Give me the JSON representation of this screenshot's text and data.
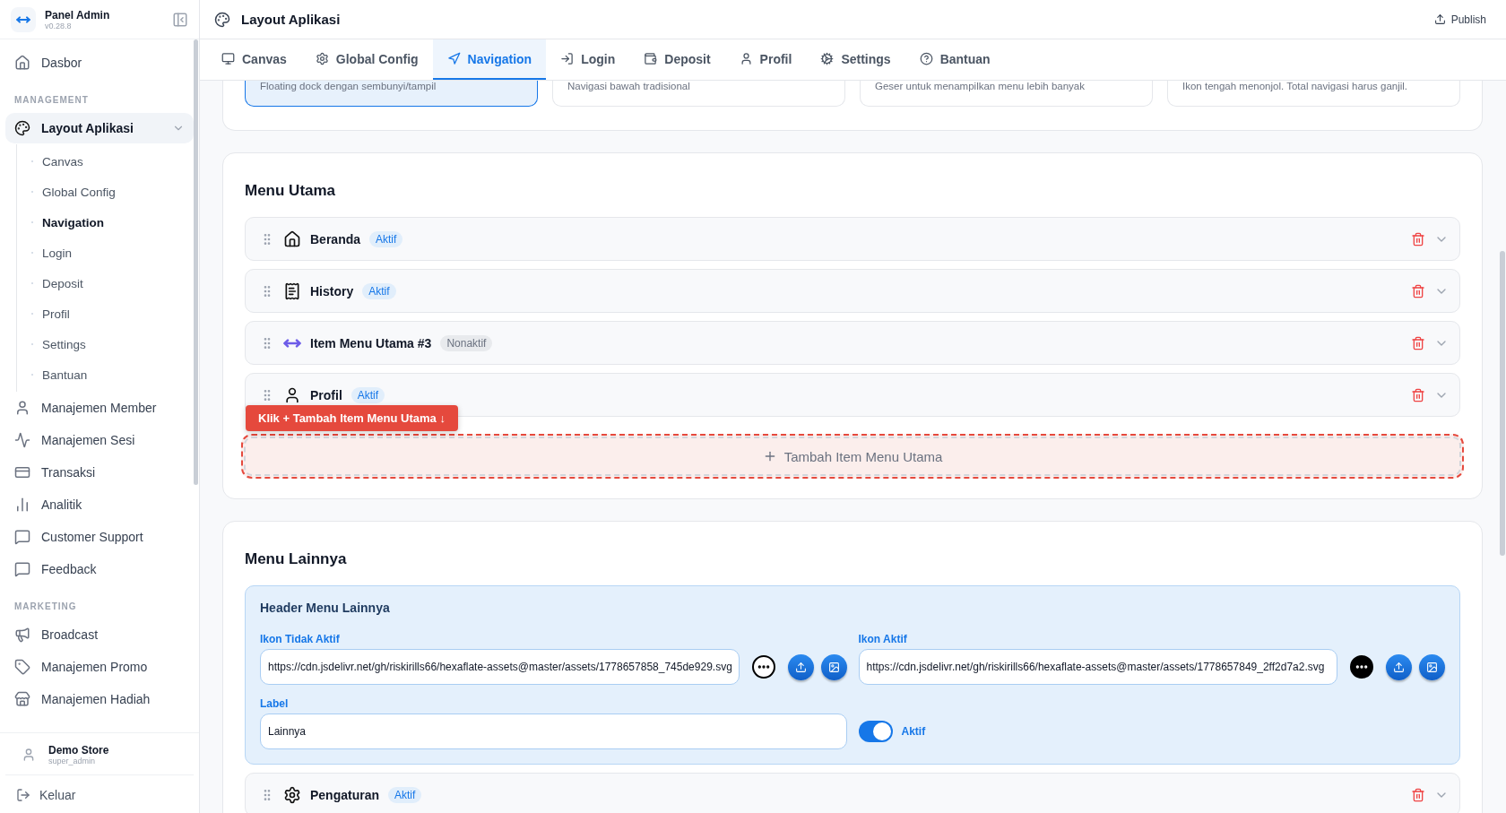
{
  "brand": {
    "title": "Panel Admin",
    "version": "v0.28.8"
  },
  "sidebar": {
    "sections": [
      {
        "items": [
          {
            "label": "Dasbor",
            "selected": false
          }
        ]
      },
      {
        "title": "MANAGEMENT",
        "items": [
          {
            "label": "Layout Aplikasi",
            "selected": true,
            "expanded": true,
            "children": [
              {
                "label": "Canvas",
                "selected": false
              },
              {
                "label": "Global Config",
                "selected": false
              },
              {
                "label": "Navigation",
                "selected": true
              },
              {
                "label": "Login",
                "selected": false
              },
              {
                "label": "Deposit",
                "selected": false
              },
              {
                "label": "Profil",
                "selected": false
              },
              {
                "label": "Settings",
                "selected": false
              },
              {
                "label": "Bantuan",
                "selected": false
              }
            ]
          },
          {
            "label": "Manajemen Member",
            "selected": false
          },
          {
            "label": "Manajemen Sesi",
            "selected": false
          },
          {
            "label": "Transaksi",
            "selected": false
          },
          {
            "label": "Analitik",
            "selected": false
          },
          {
            "label": "Customer Support",
            "selected": false
          },
          {
            "label": "Feedback",
            "selected": false
          }
        ]
      },
      {
        "title": "MARKETING",
        "items": [
          {
            "label": "Broadcast",
            "selected": false
          },
          {
            "label": "Manajemen Promo",
            "selected": false
          },
          {
            "label": "Manajemen Hadiah",
            "selected": false
          }
        ]
      }
    ]
  },
  "user": {
    "name": "Demo Store",
    "role": "super_admin"
  },
  "logout": "Keluar",
  "page": {
    "title": "Layout Aplikasi",
    "publish": "Publish"
  },
  "tabs": [
    {
      "label": "Canvas",
      "selected": false
    },
    {
      "label": "Global Config",
      "selected": false
    },
    {
      "label": "Navigation",
      "selected": true
    },
    {
      "label": "Login",
      "selected": false
    },
    {
      "label": "Deposit",
      "selected": false
    },
    {
      "label": "Profil",
      "selected": false
    },
    {
      "label": "Settings",
      "selected": false
    },
    {
      "label": "Bantuan",
      "selected": false
    }
  ],
  "nav_styles": [
    {
      "description": "Floating dock dengan sembunyi/tampil",
      "selected": true
    },
    {
      "description": "Navigasi bawah tradisional",
      "selected": false
    },
    {
      "description": "Geser untuk menampilkan menu lebih banyak",
      "selected": false
    },
    {
      "description": "Ikon tengah menonjol. Total navigasi harus ganjil.",
      "selected": false
    }
  ],
  "menu_utama": {
    "title": "Menu Utama",
    "items": [
      {
        "label": "Beranda",
        "badge": "Aktif",
        "active": true
      },
      {
        "label": "History",
        "badge": "Aktif",
        "active": true
      },
      {
        "label": "Item Menu Utama #3",
        "badge": "Nonaktif",
        "active": false
      },
      {
        "label": "Profil",
        "badge": "Aktif",
        "active": true
      }
    ],
    "hint": "Klik + Tambah Item Menu Utama ↓",
    "add_button": "Tambah Item Menu Utama"
  },
  "menu_lainnya": {
    "title": "Menu Lainnya",
    "header": {
      "title": "Header Menu Lainnya",
      "icons": [
        {
          "label": "Ikon Tidak Aktif",
          "value": "https://cdn.jsdelivr.net/gh/riskirills66/hexaflate-assets@master/assets/1778657858_745de929.svg"
        },
        {
          "label": "Ikon Aktif",
          "value": "https://cdn.jsdelivr.net/gh/riskirills66/hexaflate-assets@master/assets/1778657849_2ff2d7a2.svg"
        }
      ],
      "label_field": {
        "label": "Label",
        "value": "Lainnya"
      },
      "toggle": {
        "label": "Aktif",
        "on": true
      }
    },
    "items": [
      {
        "label": "Pengaturan",
        "badge": "Aktif",
        "active": true
      }
    ]
  }
}
